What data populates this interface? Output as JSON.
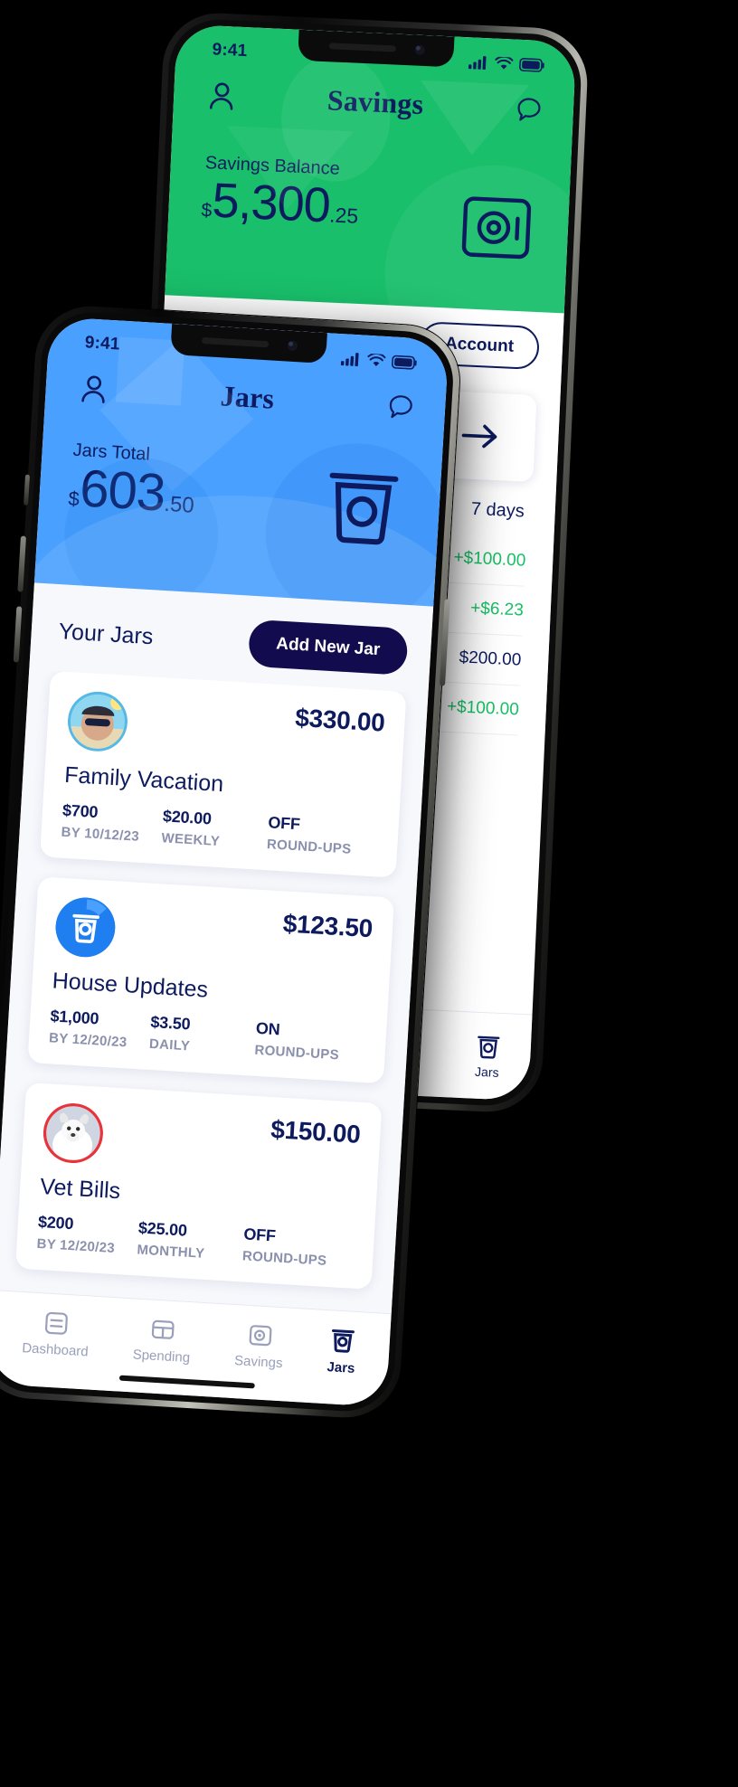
{
  "back_phone": {
    "status_bar": {
      "time": "9:41",
      "signal_icon": "cellular-bars-icon",
      "wifi_icon": "wifi-icon",
      "battery_icon": "battery-icon"
    },
    "nav": {
      "profile_icon": "person-icon",
      "title": "Savings",
      "chat_icon": "chat-bubble-icon"
    },
    "balance": {
      "label": "Savings Balance",
      "currency": "$",
      "whole": "5,300",
      "cents": ".25",
      "safe_icon": "safe-box-icon"
    },
    "account_button": "Account",
    "arrow_card": {
      "icon": "arrow-right-icon"
    },
    "period": "7 days",
    "transactions": [
      {
        "amount": "+$100.00",
        "positive": true
      },
      {
        "amount": "+$6.23",
        "positive": true
      },
      {
        "amount": "$200.00",
        "positive": false
      },
      {
        "amount": "+$100.00",
        "positive": true
      }
    ],
    "tab": {
      "icon": "jar-icon",
      "label": "Jars"
    }
  },
  "front_phone": {
    "status_bar": {
      "time": "9:41",
      "signal_icon": "cellular-bars-icon",
      "wifi_icon": "wifi-icon",
      "battery_icon": "battery-icon"
    },
    "nav": {
      "profile_icon": "person-icon",
      "title": "Jars",
      "chat_icon": "chat-bubble-icon"
    },
    "total": {
      "label": "Jars Total",
      "currency": "$",
      "whole": "603",
      "cents": ".50",
      "jar_icon": "jar-icon"
    },
    "section": {
      "title": "Your Jars",
      "add_button": "Add New Jar"
    },
    "jars": [
      {
        "amount": "$330.00",
        "name": "Family Vacation",
        "goal_value": "$700",
        "goal_label": "BY 10/12/23",
        "contrib_value": "$20.00",
        "contrib_label": "WEEKLY",
        "roundups_value": "OFF",
        "roundups_label": "ROUND-UPS",
        "avatar": "beach-photo-avatar"
      },
      {
        "amount": "$123.50",
        "name": "House Updates",
        "goal_value": "$1,000",
        "goal_label": "BY 12/20/23",
        "contrib_value": "$3.50",
        "contrib_label": "DAILY",
        "roundups_value": "ON",
        "roundups_label": "ROUND-UPS",
        "avatar": "jar-icon-avatar"
      },
      {
        "amount": "$150.00",
        "name": "Vet Bills",
        "goal_value": "$200",
        "goal_label": "BY 12/20/23",
        "contrib_value": "$25.00",
        "contrib_label": "MONTHLY",
        "roundups_value": "OFF",
        "roundups_label": "ROUND-UPS",
        "avatar": "dog-photo-avatar"
      }
    ],
    "tabs": [
      {
        "label": "Dashboard",
        "icon": "dashboard-icon",
        "active": false
      },
      {
        "label": "Spending",
        "icon": "card-icon",
        "active": false
      },
      {
        "label": "Savings",
        "icon": "safe-box-icon",
        "active": false
      },
      {
        "label": "Jars",
        "icon": "jar-icon",
        "active": true
      }
    ]
  },
  "colors": {
    "green": "#19bf6b",
    "blue": "#49a0ff",
    "navy": "#0d1b5e",
    "deep_navy": "#120c4e",
    "positive": "#17c065",
    "muted": "#8a90ad"
  }
}
